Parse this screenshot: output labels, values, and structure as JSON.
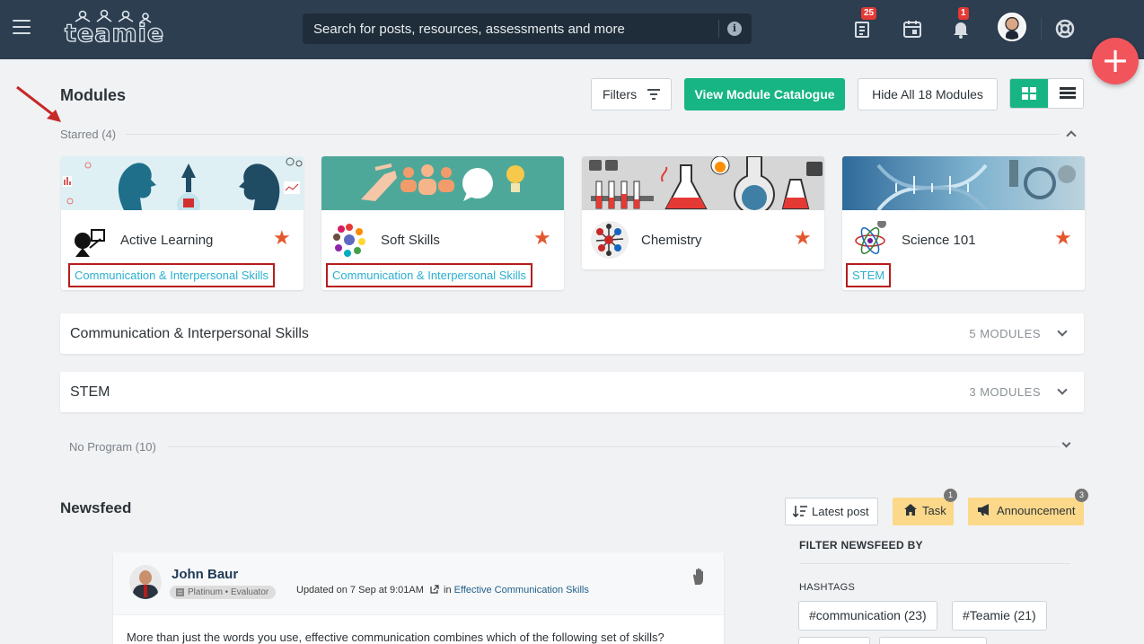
{
  "app": {
    "logo_text": "teamie"
  },
  "topbar": {
    "search_placeholder": "Search for posts, resources, assessments and more",
    "info_glyph": "i",
    "resources_badge": "25",
    "notifications_badge": "1",
    "fab_glyph": "+"
  },
  "modules": {
    "title": "Modules",
    "filters_label": "Filters",
    "catalogue_label": "View Module Catalogue",
    "hide_all_label": "Hide All 18 Modules",
    "starred_label": "Starred (4)",
    "star_glyph": "★",
    "cards": [
      {
        "title": "Active Learning",
        "program": "Communication & Interpersonal Skills"
      },
      {
        "title": "Soft Skills",
        "program": "Communication & Interpersonal Skills"
      },
      {
        "title": "Chemistry",
        "program": ""
      },
      {
        "title": "Science 101",
        "program": "STEM"
      }
    ],
    "programs": [
      {
        "name": "Communication & Interpersonal Skills",
        "count": "5 MODULES"
      },
      {
        "name": "STEM",
        "count": "3 MODULES"
      }
    ],
    "no_program_label": "No Program (10)"
  },
  "newsfeed": {
    "title": "Newsfeed",
    "sort_label": "Latest post",
    "task_label": "Task",
    "task_count": "1",
    "announcement_label": "Announcement",
    "announcement_count": "3",
    "filter_title": "FILTER NEWSFEED BY",
    "hashtags_title": "HASHTAGS",
    "hashtags": [
      "#communication (23)",
      "#Teamie (21)"
    ],
    "post": {
      "author": "John Baur",
      "badge": "Platinum • Evaluator",
      "updated": "Updated on 7 Sep at 9:01AM",
      "in_word": "in",
      "classroom": "Effective Communication Skills",
      "body": "More than just the words you use, effective communication combines which of the following set of skills?"
    }
  },
  "colors": {
    "topbar": "#2c3e50",
    "accent_green": "#17b583",
    "fab_red": "#f2545b",
    "star": "#e4572e",
    "tag_link": "#2ab0cf"
  }
}
